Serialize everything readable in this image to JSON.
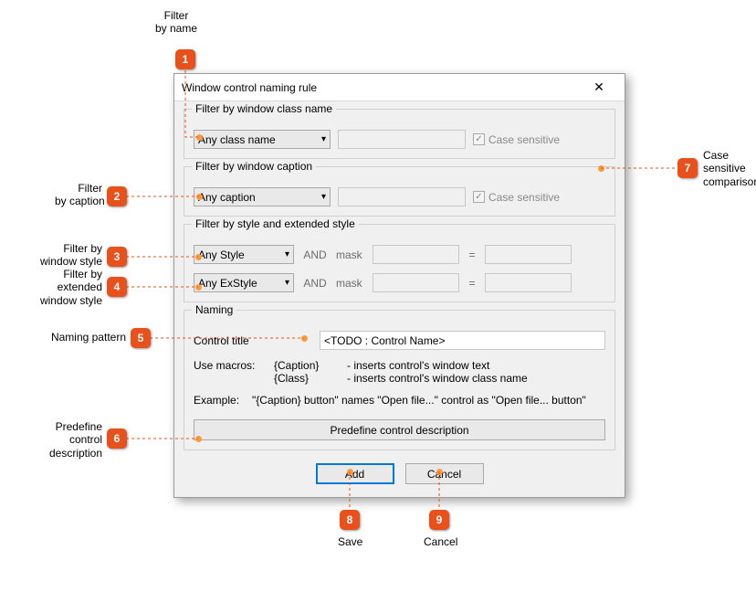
{
  "annotations": {
    "1": {
      "label": "Filter\nby name"
    },
    "2": {
      "label": "Filter\nby caption"
    },
    "3": {
      "label": "Filter by\nwindow style"
    },
    "4": {
      "label": "Filter by\nextended\nwindow style"
    },
    "5": {
      "label": "Naming pattern"
    },
    "6": {
      "label": "Predefine\ncontrol\ndescription"
    },
    "7": {
      "label": "Case\nsensitive\ncomparison"
    },
    "8": {
      "label": "Save"
    },
    "9": {
      "label": "Cancel"
    }
  },
  "dialog": {
    "title": "Window control naming rule",
    "close_glyph": "✕",
    "group_classname": {
      "legend": "Filter by window class name",
      "combo": "Any class name",
      "case_label": "Case sensitive"
    },
    "group_caption": {
      "legend": "Filter by window caption",
      "combo": "Any caption",
      "case_label": "Case sensitive"
    },
    "group_style": {
      "legend": "Filter by style and extended style",
      "style_combo": "Any Style",
      "exstyle_combo": "Any ExStyle",
      "and_label": "AND",
      "mask_label": "mask",
      "eq_label": "="
    },
    "group_naming": {
      "legend": "Naming",
      "control_title_label": "Control title",
      "control_title_value": "<TODO : Control Name>",
      "use_macros_label": "Use macros:",
      "macro1": "{Caption}",
      "macro1_desc": "- inserts control's window text",
      "macro2": "{Class}",
      "macro2_desc": "- inserts control's window class name",
      "example_label": "Example:",
      "example_text": "\"{Caption} button\" names \"Open file...\" control as \"Open file... button\"",
      "predefine_button": "Predefine control description"
    },
    "footer": {
      "add": "Add",
      "cancel": "Cancel"
    }
  }
}
